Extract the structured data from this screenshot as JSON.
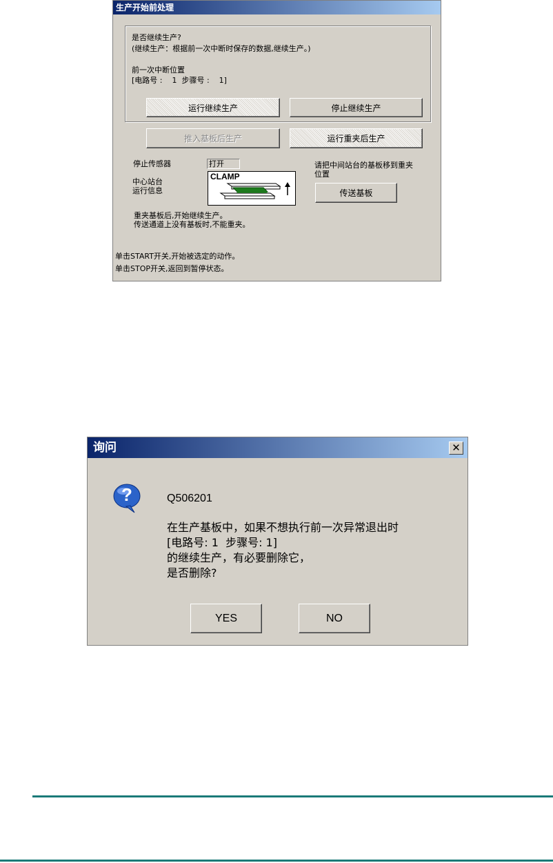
{
  "dialog1": {
    "title": "生产开始前处理",
    "question": "是否继续生产?",
    "explanation": "(继续生产：根据前一次中断时保存的数据,继续生产。)",
    "last_position_label": "前一次中断位置",
    "last_position_value": "[电路号 :    1  步骤号 :    1]",
    "btn_run_continue": "运行继续生产",
    "btn_stop_continue": "停止继续生产",
    "btn_insert_board": "推入基板后生产",
    "btn_run_reclamp": "运行重夹后生产",
    "stop_sensor_label": "停止传感器",
    "stop_sensor_value": "打开",
    "center_station_label": "中心站台\n运行信息",
    "clamp_label": "CLAMP",
    "move_board_hint": "请把中间站台的基板移到重夹\n位置",
    "btn_transfer_board": "传送基板",
    "reclamp_note": "重夹基板后,开始继续生产。\n传送通道上没有基板时,不能重夹。",
    "start_hint": "单击START开关,开始被选定的动作。",
    "stop_hint": "单击STOP开关,返回到暂停状态。"
  },
  "dialog2": {
    "title": "询问",
    "close_glyph": "✕",
    "icon_glyph": "?",
    "code": "Q506201",
    "message": "在生产基板中，如果不想执行前一次异常退出时\n[电路号: 1  步骤号: 1]\n的继续生产，有必要删除它，\n是否删除?",
    "yes_label": "YES",
    "no_label": "NO"
  },
  "colors": {
    "titlebar_start": "#0a246a",
    "titlebar_end": "#a6caf0",
    "dialog_face": "#d4d0c8",
    "rule": "#1a7a78",
    "pcb_green": "#1e7d1e"
  }
}
